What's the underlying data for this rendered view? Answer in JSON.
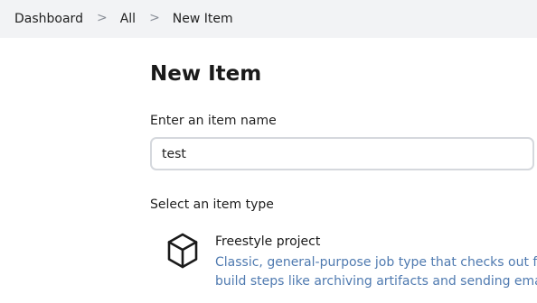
{
  "breadcrumb": {
    "items": [
      "Dashboard",
      "All",
      "New Item"
    ],
    "separator": ">"
  },
  "page": {
    "title": "New Item"
  },
  "item_name": {
    "label": "Enter an item name",
    "value": "test"
  },
  "item_type": {
    "label": "Select an item type",
    "options": [
      {
        "title": "Freestyle project",
        "description_line1": "Classic, general-purpose job type that checks out from s",
        "description_line2": "build steps like archiving artifacts and sending email no",
        "icon": "cube-icon"
      }
    ]
  },
  "colors": {
    "breadcrumb_bg": "#f2f3f5",
    "description_link": "#4f7ab0",
    "input_border": "#d5d8dd"
  }
}
